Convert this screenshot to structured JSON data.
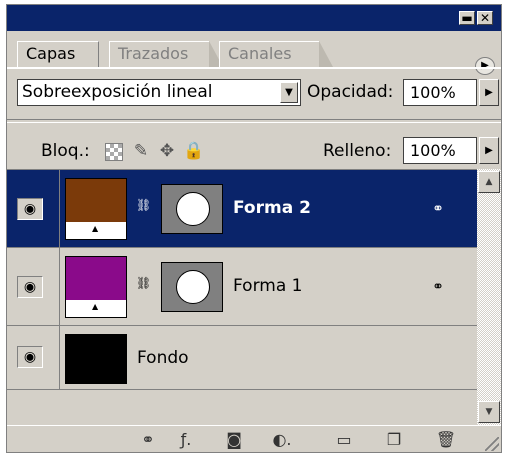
{
  "window": {
    "minimize_glyph": "▬",
    "close_glyph": "✕"
  },
  "tabs": [
    {
      "label": "Capas",
      "active": true
    },
    {
      "label": "Trazados",
      "active": false
    },
    {
      "label": "Canales",
      "active": false
    }
  ],
  "panel_menu_glyph": "▶",
  "blend": {
    "mode": "Sobreexposición lineal",
    "opacity_label": "Opacidad:",
    "opacity_value": "100%"
  },
  "lock": {
    "label": "Bloq.:",
    "fill_label": "Relleno:",
    "fill_value": "100%",
    "icons": [
      "lock-transparent-pixels-icon",
      "lock-image-pixels-icon",
      "lock-position-icon",
      "lock-all-icon"
    ]
  },
  "layers": [
    {
      "name": "Forma 2",
      "color": "#7b3a0a",
      "selected": true,
      "type": "shape"
    },
    {
      "name": "Forma 1",
      "color": "#8a0a8a",
      "selected": false,
      "type": "shape"
    },
    {
      "name": "Fondo",
      "color": "#000000",
      "selected": false,
      "type": "background"
    }
  ],
  "bottom_icons": [
    "link-layers-icon",
    "layer-style-icon",
    "layer-mask-icon",
    "adjustment-layer-icon",
    "new-group-icon",
    "new-layer-icon",
    "trash-icon"
  ],
  "colors": {
    "panel_bg": "#d4d0c8",
    "selection": "#0a246a"
  }
}
